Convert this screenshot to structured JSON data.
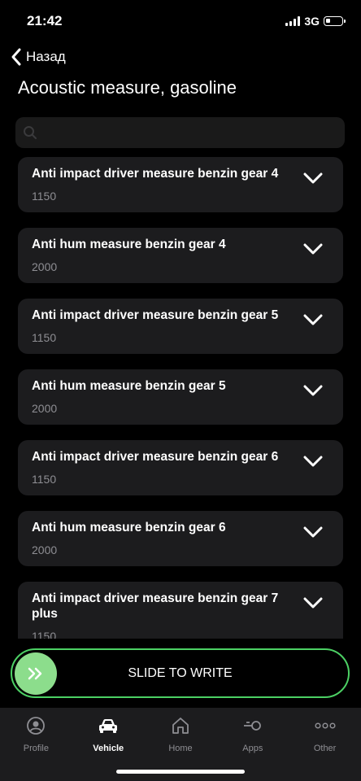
{
  "status_bar": {
    "time": "21:42",
    "network": "3G",
    "battery_level": 0.3
  },
  "nav": {
    "back_label": "Назад",
    "title": "Acoustic measure, gasoline"
  },
  "search": {
    "placeholder": ""
  },
  "items": [
    {
      "title": "Anti impact driver measure benzin gear 4",
      "value": "1150"
    },
    {
      "title": "Anti hum measure benzin gear 4",
      "value": "2000"
    },
    {
      "title": "Anti impact driver measure benzin gear 5",
      "value": "1150"
    },
    {
      "title": "Anti hum measure benzin gear 5",
      "value": "2000"
    },
    {
      "title": "Anti impact driver measure benzin gear 6",
      "value": "1150"
    },
    {
      "title": "Anti hum measure benzin gear 6",
      "value": "2000"
    },
    {
      "title": "Anti impact driver measure benzin gear 7 plus",
      "value": "1150"
    },
    {
      "title": "",
      "value": ""
    }
  ],
  "slider": {
    "label": "SLIDE TO WRITE",
    "accent": "#4cd064"
  },
  "tabs": [
    {
      "label": "Profile",
      "icon": "profile-icon"
    },
    {
      "label": "Vehicle",
      "icon": "car-icon"
    },
    {
      "label": "Home",
      "icon": "home-icon"
    },
    {
      "label": "Apps",
      "icon": "apps-icon"
    },
    {
      "label": "Other",
      "icon": "more-icon"
    }
  ]
}
